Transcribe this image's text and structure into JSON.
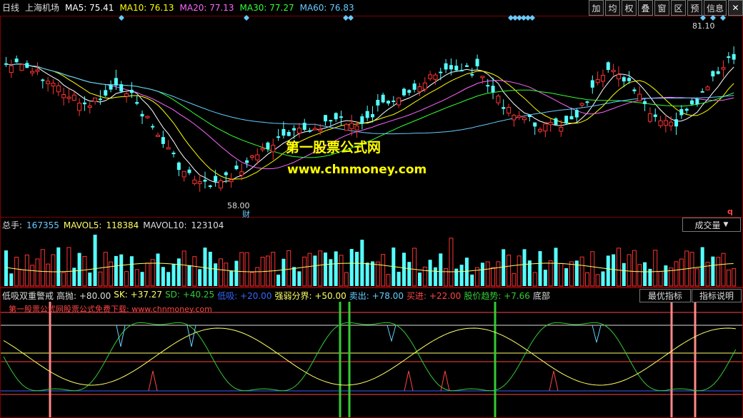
{
  "toolbar": {
    "period_label": "日线",
    "stock_name": "上海机场",
    "buttons": [
      "加",
      "均",
      "权",
      "叠",
      "窗",
      "区",
      "预",
      "信息"
    ],
    "close_label": "✕"
  },
  "ma": [
    {
      "label": "MA5:",
      "value": "75.41",
      "color": "#ffffff"
    },
    {
      "label": "MA10:",
      "value": "76.13",
      "color": "#ffff00"
    },
    {
      "label": "MA20:",
      "value": "77.13",
      "color": "#ff66ff"
    },
    {
      "label": "MA30:",
      "value": "77.27",
      "color": "#33ff33"
    },
    {
      "label": "MA60:",
      "value": "76.83",
      "color": "#66ccff"
    }
  ],
  "price": {
    "high_label": "81.10",
    "low_label": "58.00",
    "finance_mark": "财",
    "q_mark": "q"
  },
  "watermark": {
    "cn": "第一股票公式网",
    "url": "www.chnmoney.com"
  },
  "volume": {
    "total_label": "总手:",
    "total_value": "167355",
    "mavol5_label": "MAVOL5:",
    "mavol5_value": "118384",
    "mavol10_label": "MAVOL10:",
    "mavol10_value": "123104",
    "dropdown": "成交量"
  },
  "indicator": {
    "name": "低吸双重警戒",
    "items": [
      {
        "label": "高抛:",
        "value": "+80.00",
        "color": "#dddddd"
      },
      {
        "label": "SK:",
        "value": "+37.27",
        "color": "#ffff66"
      },
      {
        "label": "SD:",
        "value": "+40.25",
        "color": "#33cc33"
      },
      {
        "label": "低吸:",
        "value": "+20.00",
        "color": "#3366ff"
      },
      {
        "label": "强弱分界:",
        "value": "+50.00",
        "color": "#ffff66"
      },
      {
        "label": "卖出:",
        "value": "+78.00",
        "color": "#66ccff"
      },
      {
        "label": "买进:",
        "value": "+22.00",
        "color": "#ff4444"
      },
      {
        "label": "股价趋势:",
        "value": "+7.66",
        "color": "#33cc33"
      }
    ],
    "bottom_label": "底部",
    "best_button": "最优指标",
    "help_button": "指标说明",
    "download_note": "第一股票公式网股票公式免费下载: www.chnmoney.com"
  },
  "colors": {
    "up": "#ff3333",
    "down": "#55ffff",
    "frame": "#800000"
  }
}
